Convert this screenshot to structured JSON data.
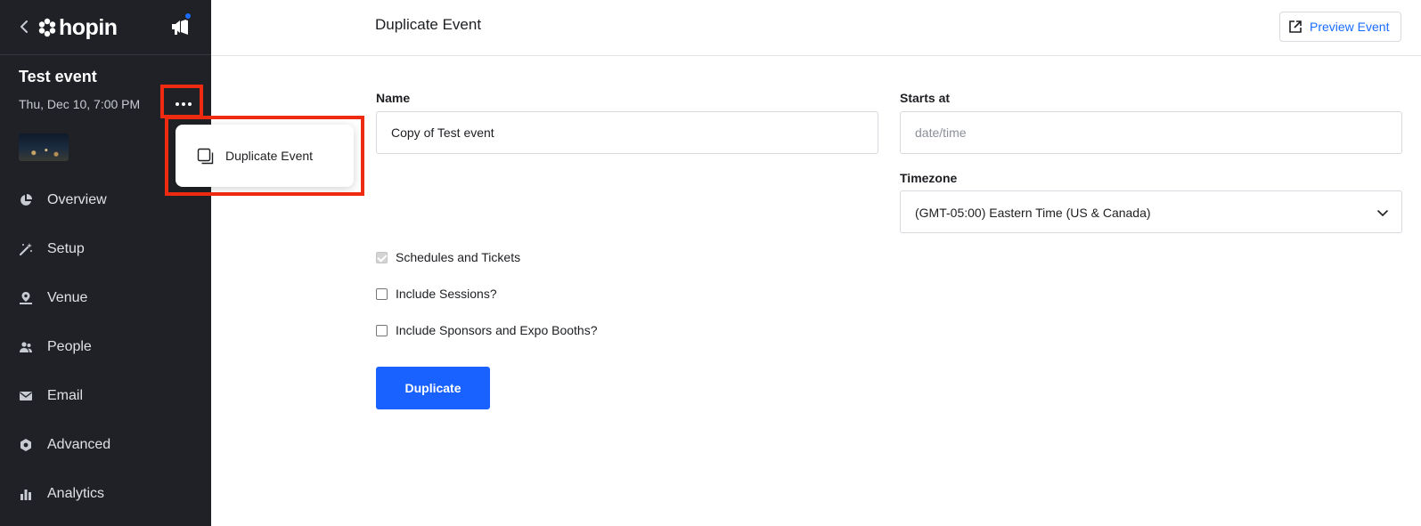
{
  "sidebar": {
    "brand": "hopin",
    "event_title": "Test event",
    "event_date": "Thu, Dec 10, 7:00 PM",
    "nav": [
      {
        "label": "Overview",
        "icon": "pie-chart-icon"
      },
      {
        "label": "Setup",
        "icon": "magic-wand-icon"
      },
      {
        "label": "Venue",
        "icon": "venue-pin-icon"
      },
      {
        "label": "People",
        "icon": "people-icon"
      },
      {
        "label": "Email",
        "icon": "envelope-icon"
      },
      {
        "label": "Advanced",
        "icon": "hexagon-gear-icon"
      },
      {
        "label": "Analytics",
        "icon": "bar-chart-icon"
      }
    ]
  },
  "menu": {
    "duplicate_label": "Duplicate Event"
  },
  "header": {
    "title": "Duplicate Event",
    "preview_label": "Preview Event"
  },
  "form": {
    "name_label": "Name",
    "name_value": "Copy of Test event",
    "starts_label": "Starts at",
    "starts_placeholder": "date/time",
    "timezone_label": "Timezone",
    "timezone_value": "(GMT-05:00) Eastern Time (US & Canada)",
    "options": [
      {
        "label": "Schedules and Tickets",
        "checked": true,
        "disabled": true
      },
      {
        "label": "Include Sessions?",
        "checked": false,
        "disabled": false
      },
      {
        "label": "Include Sponsors and Expo Booths?",
        "checked": false,
        "disabled": false
      }
    ],
    "submit_label": "Duplicate"
  },
  "colors": {
    "sidebar_bg": "#1f2126",
    "accent": "#1a62ff",
    "highlight": "#ee2b11"
  }
}
